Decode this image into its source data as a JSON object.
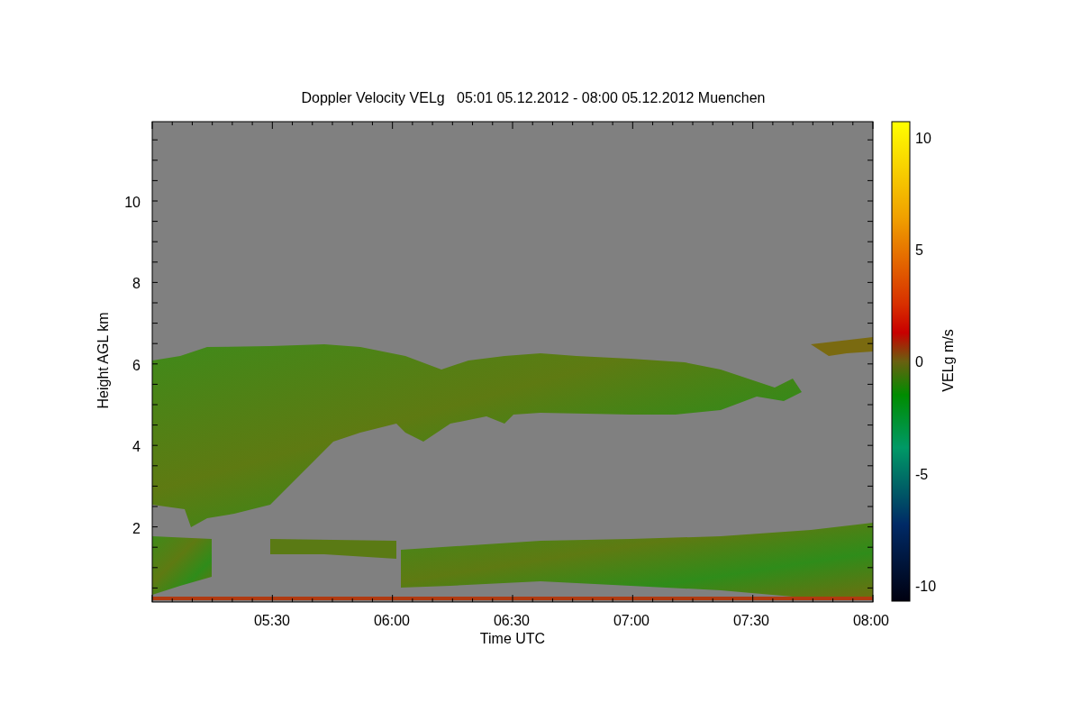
{
  "title": "Doppler Velocity VELg   05:01 05.12.2012 - 08:00 05.12.2012 Muenchen",
  "x_axis": {
    "label": "Time UTC",
    "ticks": [
      "05:30",
      "06:00",
      "06:30",
      "07:00",
      "07:30",
      "08:00"
    ]
  },
  "y_axis": {
    "label": "Height AGL km",
    "ticks": [
      "10",
      "8",
      "6",
      "4",
      "2"
    ]
  },
  "colorbar": {
    "label": "VELg m/s",
    "ticks": [
      "10",
      "5",
      "0",
      "-5",
      "-10"
    ]
  }
}
